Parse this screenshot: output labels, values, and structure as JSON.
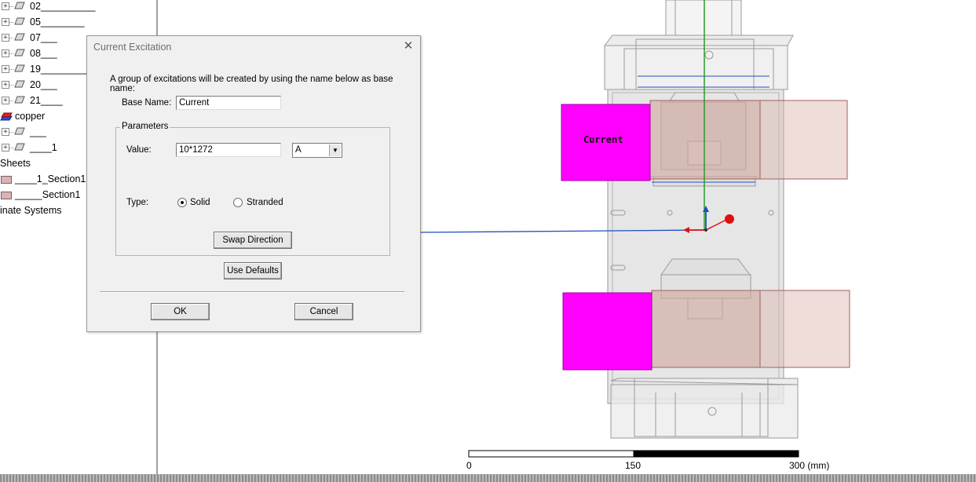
{
  "tree": {
    "items": [
      {
        "label": "02__________",
        "kind": "object"
      },
      {
        "label": "05________",
        "kind": "object"
      },
      {
        "label": "07___",
        "kind": "object"
      },
      {
        "label": "08___",
        "kind": "object"
      },
      {
        "label": "19__________",
        "kind": "object"
      },
      {
        "label": "20___",
        "kind": "object"
      },
      {
        "label": "21____",
        "kind": "object"
      },
      {
        "label": "copper",
        "kind": "material"
      },
      {
        "label": "___",
        "kind": "object"
      },
      {
        "label": "____1",
        "kind": "object"
      }
    ],
    "sheets_label": "Sheets",
    "sheet_items": [
      "____1_Section1",
      "_____Section1"
    ],
    "coord_label": "inate Systems"
  },
  "viewport": {
    "excitation_label": "Current",
    "scale": {
      "tick0": "0",
      "tick1": "150",
      "tick2": "300 (mm)"
    }
  },
  "dialog": {
    "title": "Current Excitation",
    "description": "A group of excitations will be created by using the name below as base name:",
    "base_name_label": "Base Name:",
    "base_name_value": "Current",
    "parameters_label": "Parameters",
    "value_label": "Value:",
    "value_value": "10*1272",
    "unit_value": "A",
    "type_label": "Type:",
    "type_options": [
      "Solid",
      "Stranded"
    ],
    "type_selected": "Solid",
    "swap_direction_label": "Swap Direction",
    "use_defaults_label": "Use Defaults",
    "ok_label": "OK",
    "cancel_label": "Cancel"
  },
  "colors": {
    "coil_magenta": "#ff00ff",
    "coil_pink": "#d9b3ab",
    "axis_blue": "#2050c0",
    "axis_green": "#2a9a2a",
    "axis_red": "#e01010"
  }
}
